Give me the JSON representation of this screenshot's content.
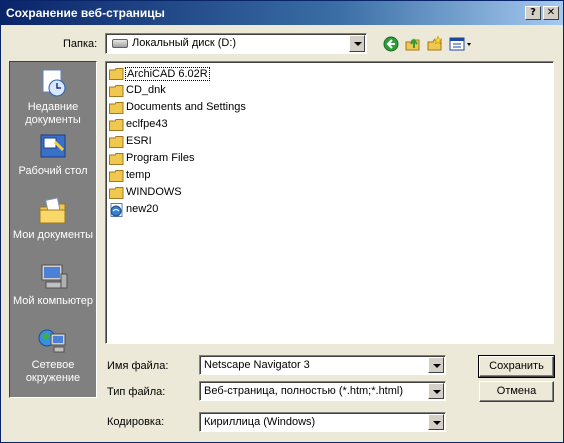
{
  "window": {
    "title": "Сохранение веб-страницы"
  },
  "titlebar": {
    "help_label": "?",
    "close_label": "✕"
  },
  "lookin": {
    "label": "Папка:",
    "value": "Локальный диск (D:)"
  },
  "toolbar": {
    "icons": [
      "back-icon",
      "up-folder-icon",
      "new-folder-icon",
      "view-menu-icon"
    ]
  },
  "places": [
    {
      "label": "Недавние документы",
      "icon": "recent-documents-icon"
    },
    {
      "label": "Рабочий стол",
      "icon": "desktop-icon"
    },
    {
      "label": "Мои документы",
      "icon": "my-documents-icon"
    },
    {
      "label": "Мой компьютер",
      "icon": "my-computer-icon"
    },
    {
      "label": "Сетевое окружение",
      "icon": "network-icon"
    }
  ],
  "files": [
    {
      "name": "ArchiCAD 6.02R",
      "type": "folder"
    },
    {
      "name": "CD_dnk",
      "type": "folder"
    },
    {
      "name": "Documents and Settings",
      "type": "folder"
    },
    {
      "name": "eclfpe43",
      "type": "folder"
    },
    {
      "name": "ESRI",
      "type": "folder"
    },
    {
      "name": "Program Files",
      "type": "folder"
    },
    {
      "name": "temp",
      "type": "folder"
    },
    {
      "name": "WINDOWS",
      "type": "folder"
    },
    {
      "name": "new20",
      "type": "html"
    }
  ],
  "filename": {
    "label": "Имя файла:",
    "value": "Netscape Navigator 3"
  },
  "filetype": {
    "label": "Тип файла:",
    "value": "Веб-страница, полностью (*.htm;*.html)"
  },
  "encoding": {
    "label": "Кодировка:",
    "value": "Кириллица (Windows)"
  },
  "buttons": {
    "save": "Сохранить",
    "cancel": "Отмена"
  },
  "colors": {
    "title_bar": "#0a246a",
    "places_bg": "#808080",
    "dialog_bg": "#ece9d8"
  }
}
